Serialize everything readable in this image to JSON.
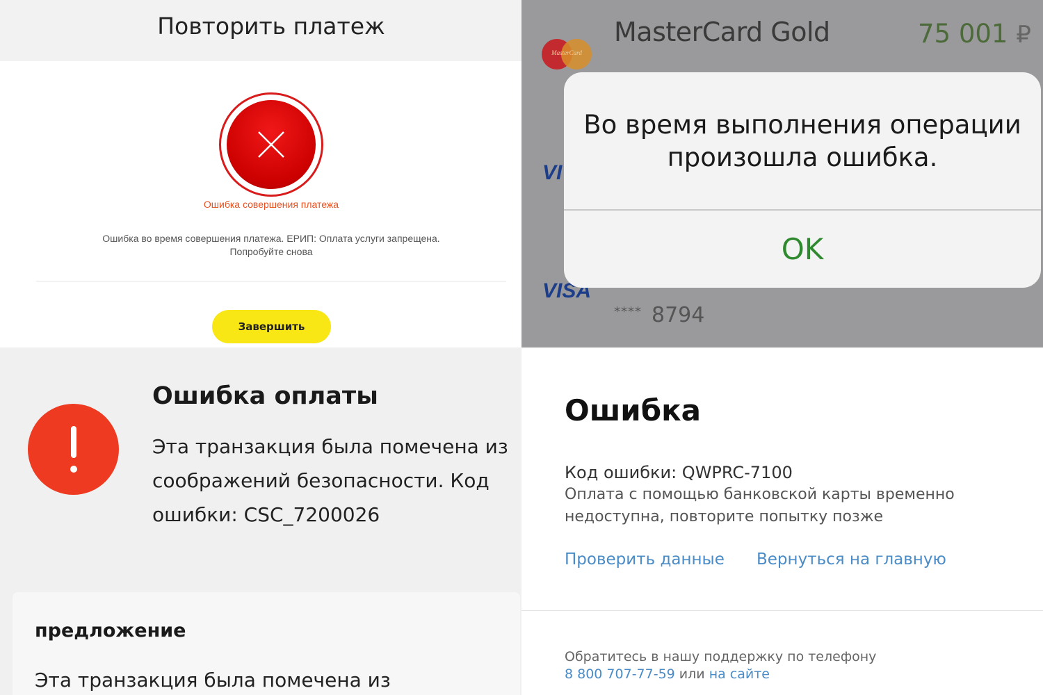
{
  "panel1": {
    "title": "Повторить платеж",
    "error_caption": "Ошибка совершения платежа",
    "error_description_line1": "Ошибка во время совершения платежа. ЕРИП: Оплата услуги запрещена.",
    "error_description_line2": "Попробуйте снова",
    "finish_button": "Завершить",
    "colors": {
      "error_red": "#d81b1b",
      "caption_orange": "#e8501f",
      "button_yellow": "#f8e715"
    },
    "icons": {
      "status": "close-icon"
    }
  },
  "panel2": {
    "card_logo_text": "MasterCard",
    "card_name": "MasterCard Gold",
    "card_balance": "75 001",
    "currency": "₽",
    "visa_label": "VISA",
    "visa_label_partial": "VI",
    "card_mask": "****",
    "card_last4": "8794",
    "alert_message_line1": "Во время выполнения операции",
    "alert_message_line2": "произошла ошибка.",
    "alert_ok": "OK",
    "colors": {
      "ok_green": "#2f8a2f",
      "balance_green": "#4d6a3a"
    }
  },
  "panel3": {
    "title": "Ошибка оплаты",
    "message": "Эта транзакция была помечена из соображений безопасности. Код ошибки: CSC_7200026",
    "suggestion_title": "предложение",
    "suggestion_text": "Эта транзакция была помечена из",
    "colors": {
      "alert_red": "#ef3a22"
    },
    "icons": {
      "status": "exclamation-icon"
    }
  },
  "panel4": {
    "title": "Ошибка",
    "error_code": "Код ошибки: QWPRC-7100",
    "description": "Оплата с помощью банковской карты временно недоступна, повторите попытку позже",
    "link_check": "Проверить данные",
    "link_home": "Вернуться на главную",
    "support_text": "Обратитесь в нашу поддержку по телефону",
    "support_phone": "8 800 707-77-59",
    "support_or": " или ",
    "support_site": "на сайте",
    "colors": {
      "link_blue": "#4a8cc7"
    }
  }
}
